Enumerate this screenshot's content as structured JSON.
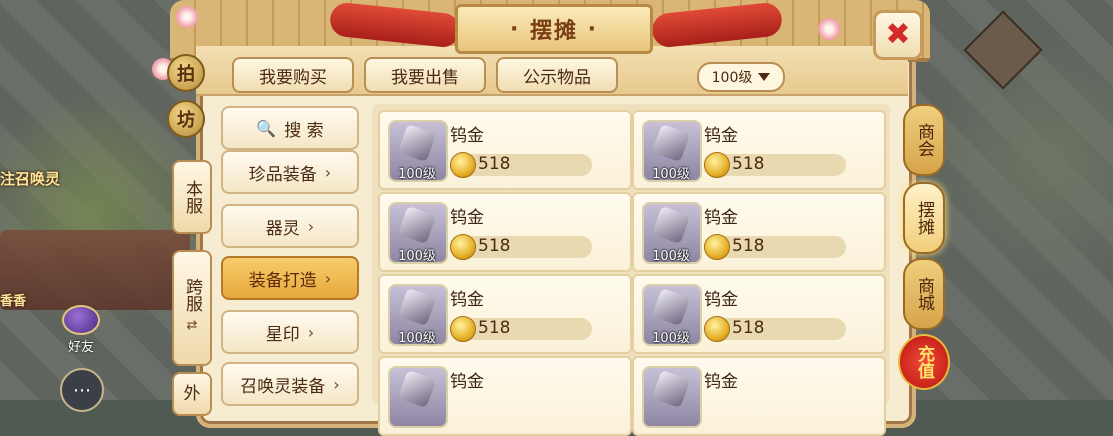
{
  "window": {
    "title": "摆摊"
  },
  "background": {
    "player_name_partial": "注召唤灵",
    "npc_name_partial": "香香",
    "friend_label": "好友"
  },
  "header": {
    "tabs": [
      "我要购买",
      "我要出售",
      "公示物品"
    ],
    "level_filter": "100级"
  },
  "left_tabs": {
    "paifang": [
      "拍",
      "坊"
    ],
    "local": "本服",
    "cross": "跨服",
    "outer_partial": "外"
  },
  "categories": [
    {
      "label": "搜 索",
      "icon": "search-icon"
    },
    {
      "label": "珍品装备"
    },
    {
      "label": "器灵"
    },
    {
      "label": "装备打造",
      "active": true
    },
    {
      "label": "星印"
    },
    {
      "label": "召唤灵装备"
    }
  ],
  "items": [
    {
      "name": "钨金",
      "level": "100级",
      "price": "518"
    },
    {
      "name": "钨金",
      "level": "100级",
      "price": "518"
    },
    {
      "name": "钨金",
      "level": "100级",
      "price": "518"
    },
    {
      "name": "钨金",
      "level": "100级",
      "price": "518"
    },
    {
      "name": "钨金",
      "level": "100级",
      "price": "518"
    },
    {
      "name": "钨金",
      "level": "100级",
      "price": "518"
    },
    {
      "name": "钨金"
    },
    {
      "name": "钨金"
    }
  ],
  "right_tabs": {
    "shop": "商会",
    "stall": "摆摊",
    "mall": "商城",
    "recharge": "充值"
  },
  "colors": {
    "accent": "#e8a83c",
    "panel": "#f6ecd1",
    "close": "#d42a2a"
  }
}
